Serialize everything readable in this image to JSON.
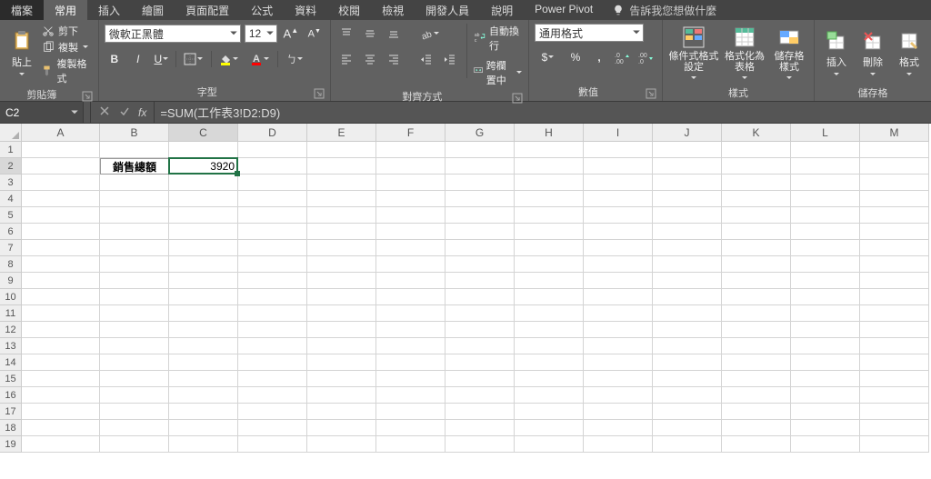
{
  "tabs": {
    "file": "檔案",
    "home": "常用",
    "insert": "插入",
    "draw": "繪圖",
    "layout": "頁面配置",
    "formulas": "公式",
    "data": "資料",
    "review": "校閱",
    "view": "檢視",
    "developer": "開發人員",
    "help": "說明",
    "powerpivot": "Power Pivot",
    "tellme": "告訴我您想做什麼"
  },
  "ribbon": {
    "clipboard": {
      "paste": "貼上",
      "cut": "剪下",
      "copy": "複製",
      "format_painter": "複製格式",
      "label": "剪貼簿"
    },
    "font": {
      "name": "微軟正黑體",
      "size": "12",
      "label": "字型"
    },
    "alignment": {
      "wrap": "自動換行",
      "merge": "跨欄置中",
      "label": "對齊方式"
    },
    "number": {
      "format": "通用格式",
      "label": "數值"
    },
    "styles": {
      "cond": "條件式格式設定",
      "table": "格式化為表格",
      "cell": "儲存格樣式",
      "label": "樣式"
    },
    "cells": {
      "insert": "插入",
      "delete": "刪除",
      "format": "格式",
      "label": "儲存格"
    }
  },
  "fx": {
    "namebox": "C2",
    "formula": "=SUM(工作表3!D2:D9)"
  },
  "sheet": {
    "cols": [
      "A",
      "B",
      "C",
      "D",
      "E",
      "F",
      "G",
      "H",
      "I",
      "J",
      "K",
      "L",
      "M"
    ],
    "b2": "銷售總額",
    "c2": "3920",
    "active": {
      "cell": "C2"
    }
  }
}
